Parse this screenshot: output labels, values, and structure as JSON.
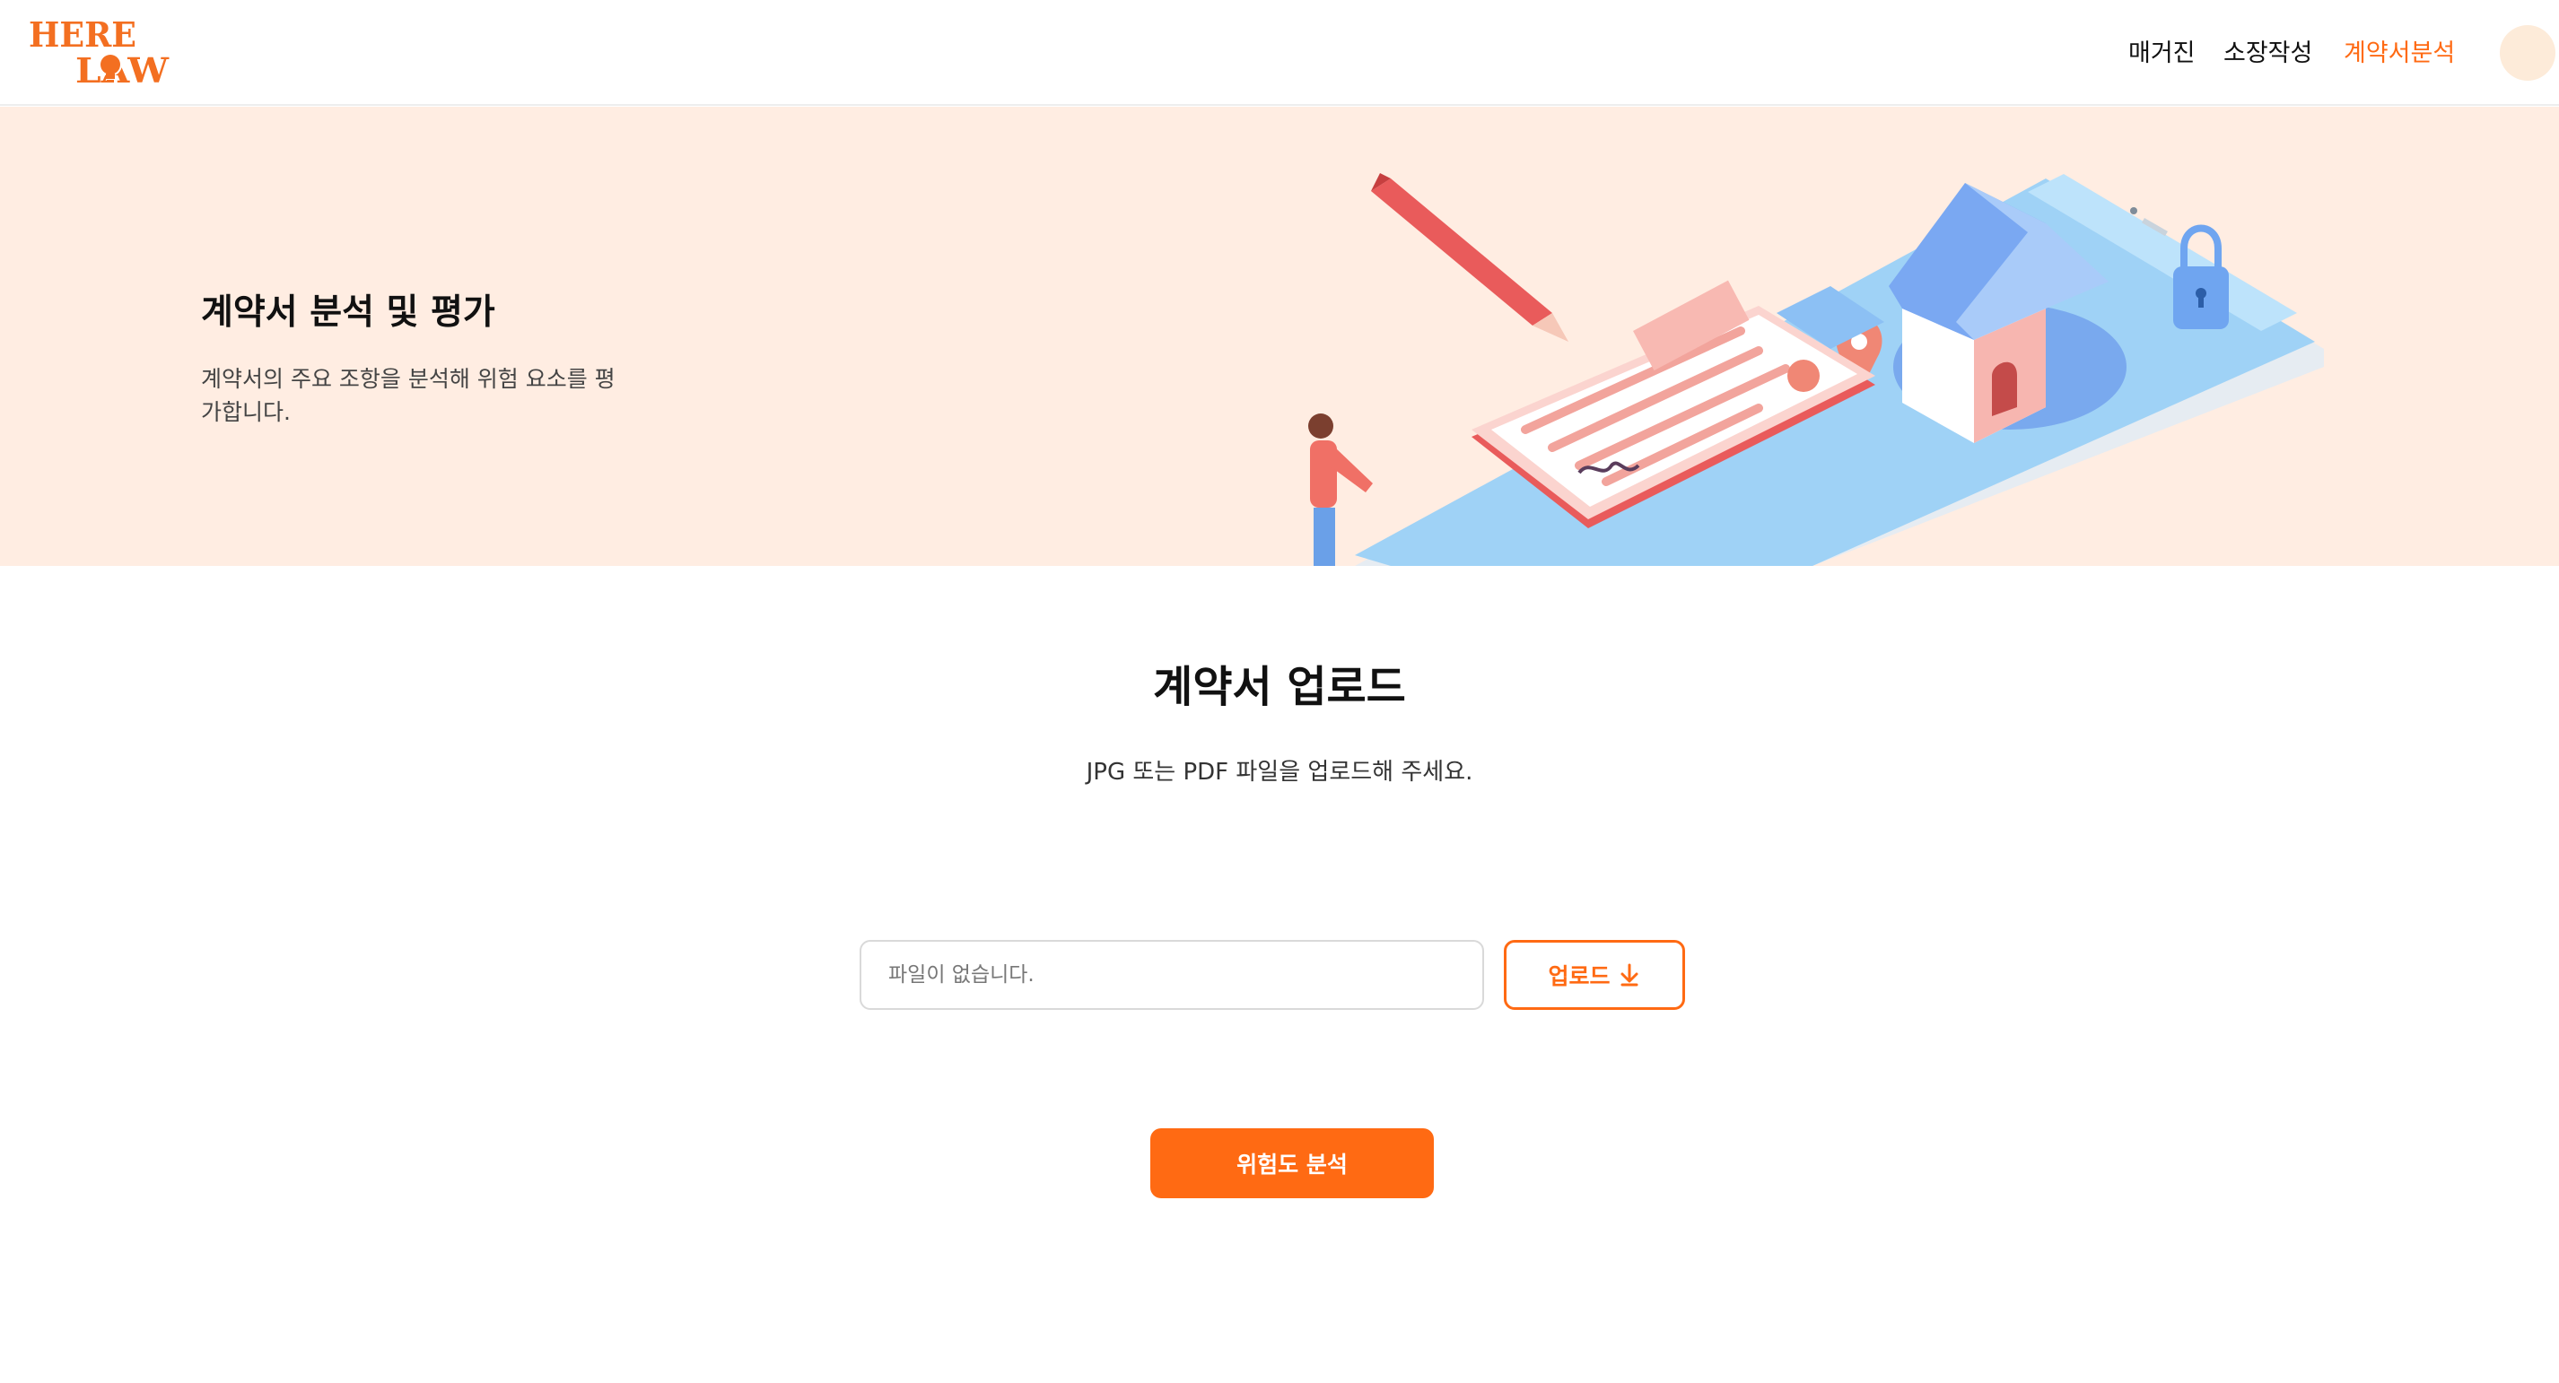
{
  "brand": {
    "logo_text_top": "HERE",
    "logo_text_bottom": "LAW",
    "color": "#ff6a13"
  },
  "nav": {
    "items": [
      {
        "label": "매거진",
        "active": false
      },
      {
        "label": "소장작성",
        "active": false
      },
      {
        "label": "계약서분석",
        "active": true
      }
    ],
    "profile_icon": "avatar-circle"
  },
  "hero": {
    "title": "계약서 분석 및 평가",
    "description": "계약서의 주요 조항을 분석해 위험 요소를 평가합니다.",
    "background": "#ffede2",
    "illustration": "contract-house-illustration"
  },
  "upload": {
    "title": "계약서 업로드",
    "description": "JPG 또는 PDF 파일을 업로드해 주세요.",
    "file_placeholder": "파일이 없습니다.",
    "upload_button_label": "업로드",
    "upload_button_icon": "download-arrow-icon",
    "analyze_button_label": "위험도 분석"
  },
  "colors": {
    "accent": "#ff6a13",
    "hero_bg": "#ffede2",
    "profile_bg": "#fdebd9"
  }
}
